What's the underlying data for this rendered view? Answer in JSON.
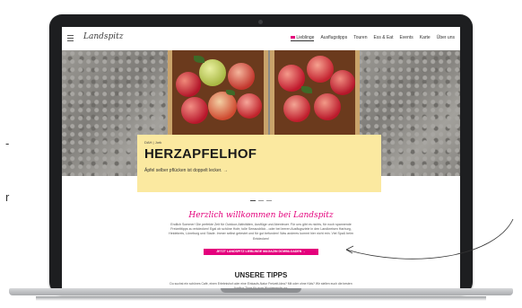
{
  "stray": {
    "dash": "-",
    "letter_r": "r"
  },
  "site": {
    "logo": "Landspitz",
    "nav": [
      {
        "label": "Lieblinge",
        "active": true
      },
      {
        "label": "Ausflugstipps"
      },
      {
        "label": "Touren"
      },
      {
        "label": "Ess & Eat"
      },
      {
        "label": "Events"
      },
      {
        "label": "Karte"
      },
      {
        "label": "Über uns"
      }
    ]
  },
  "hero": {
    "tag": "DAH | Jork",
    "title": "HERZAPFELHOF",
    "link": "Äpfel selber pflücken ist doppelt lecker. →"
  },
  "welcome": {
    "heading": "Herzlich willkommen bei Landspitz",
    "intro": "Endlich Sommer! Die perfekte Zeit für Outdoor-Aktivitäten, Ausflüge und Abenteuer. Für uns gibt es nichts, für noch spannende Freizeittipps zu entdecken! Egal ob schöne Hofe, tolle Seeausblick - oder bei leeren Ausflugsziele in den Landkreisen Harburg, Heidekreis, Lüneburg und Stade. Immer selbst getestet und für gut befunden! Was anderes kommt hier nicht rein. Viel Spaß beim Entdecken!",
    "cta": "JETZT LANDSPITZ LIEBLINGE MAGAZIN DOWNLOADEN →"
  },
  "tips": {
    "heading": "UNSERE TIPPS",
    "text": "Du suchst ein schönes Café, einen Erlebnishof oder eine Einkaufs-Natur Freizeit-Idea? Mit oder ohne Kids? Wir stellen euch die besten Ausflug-Tipps für eure Wochenende vor."
  },
  "colors": {
    "accent": "#e4007c",
    "card": "#fbe9a0"
  }
}
